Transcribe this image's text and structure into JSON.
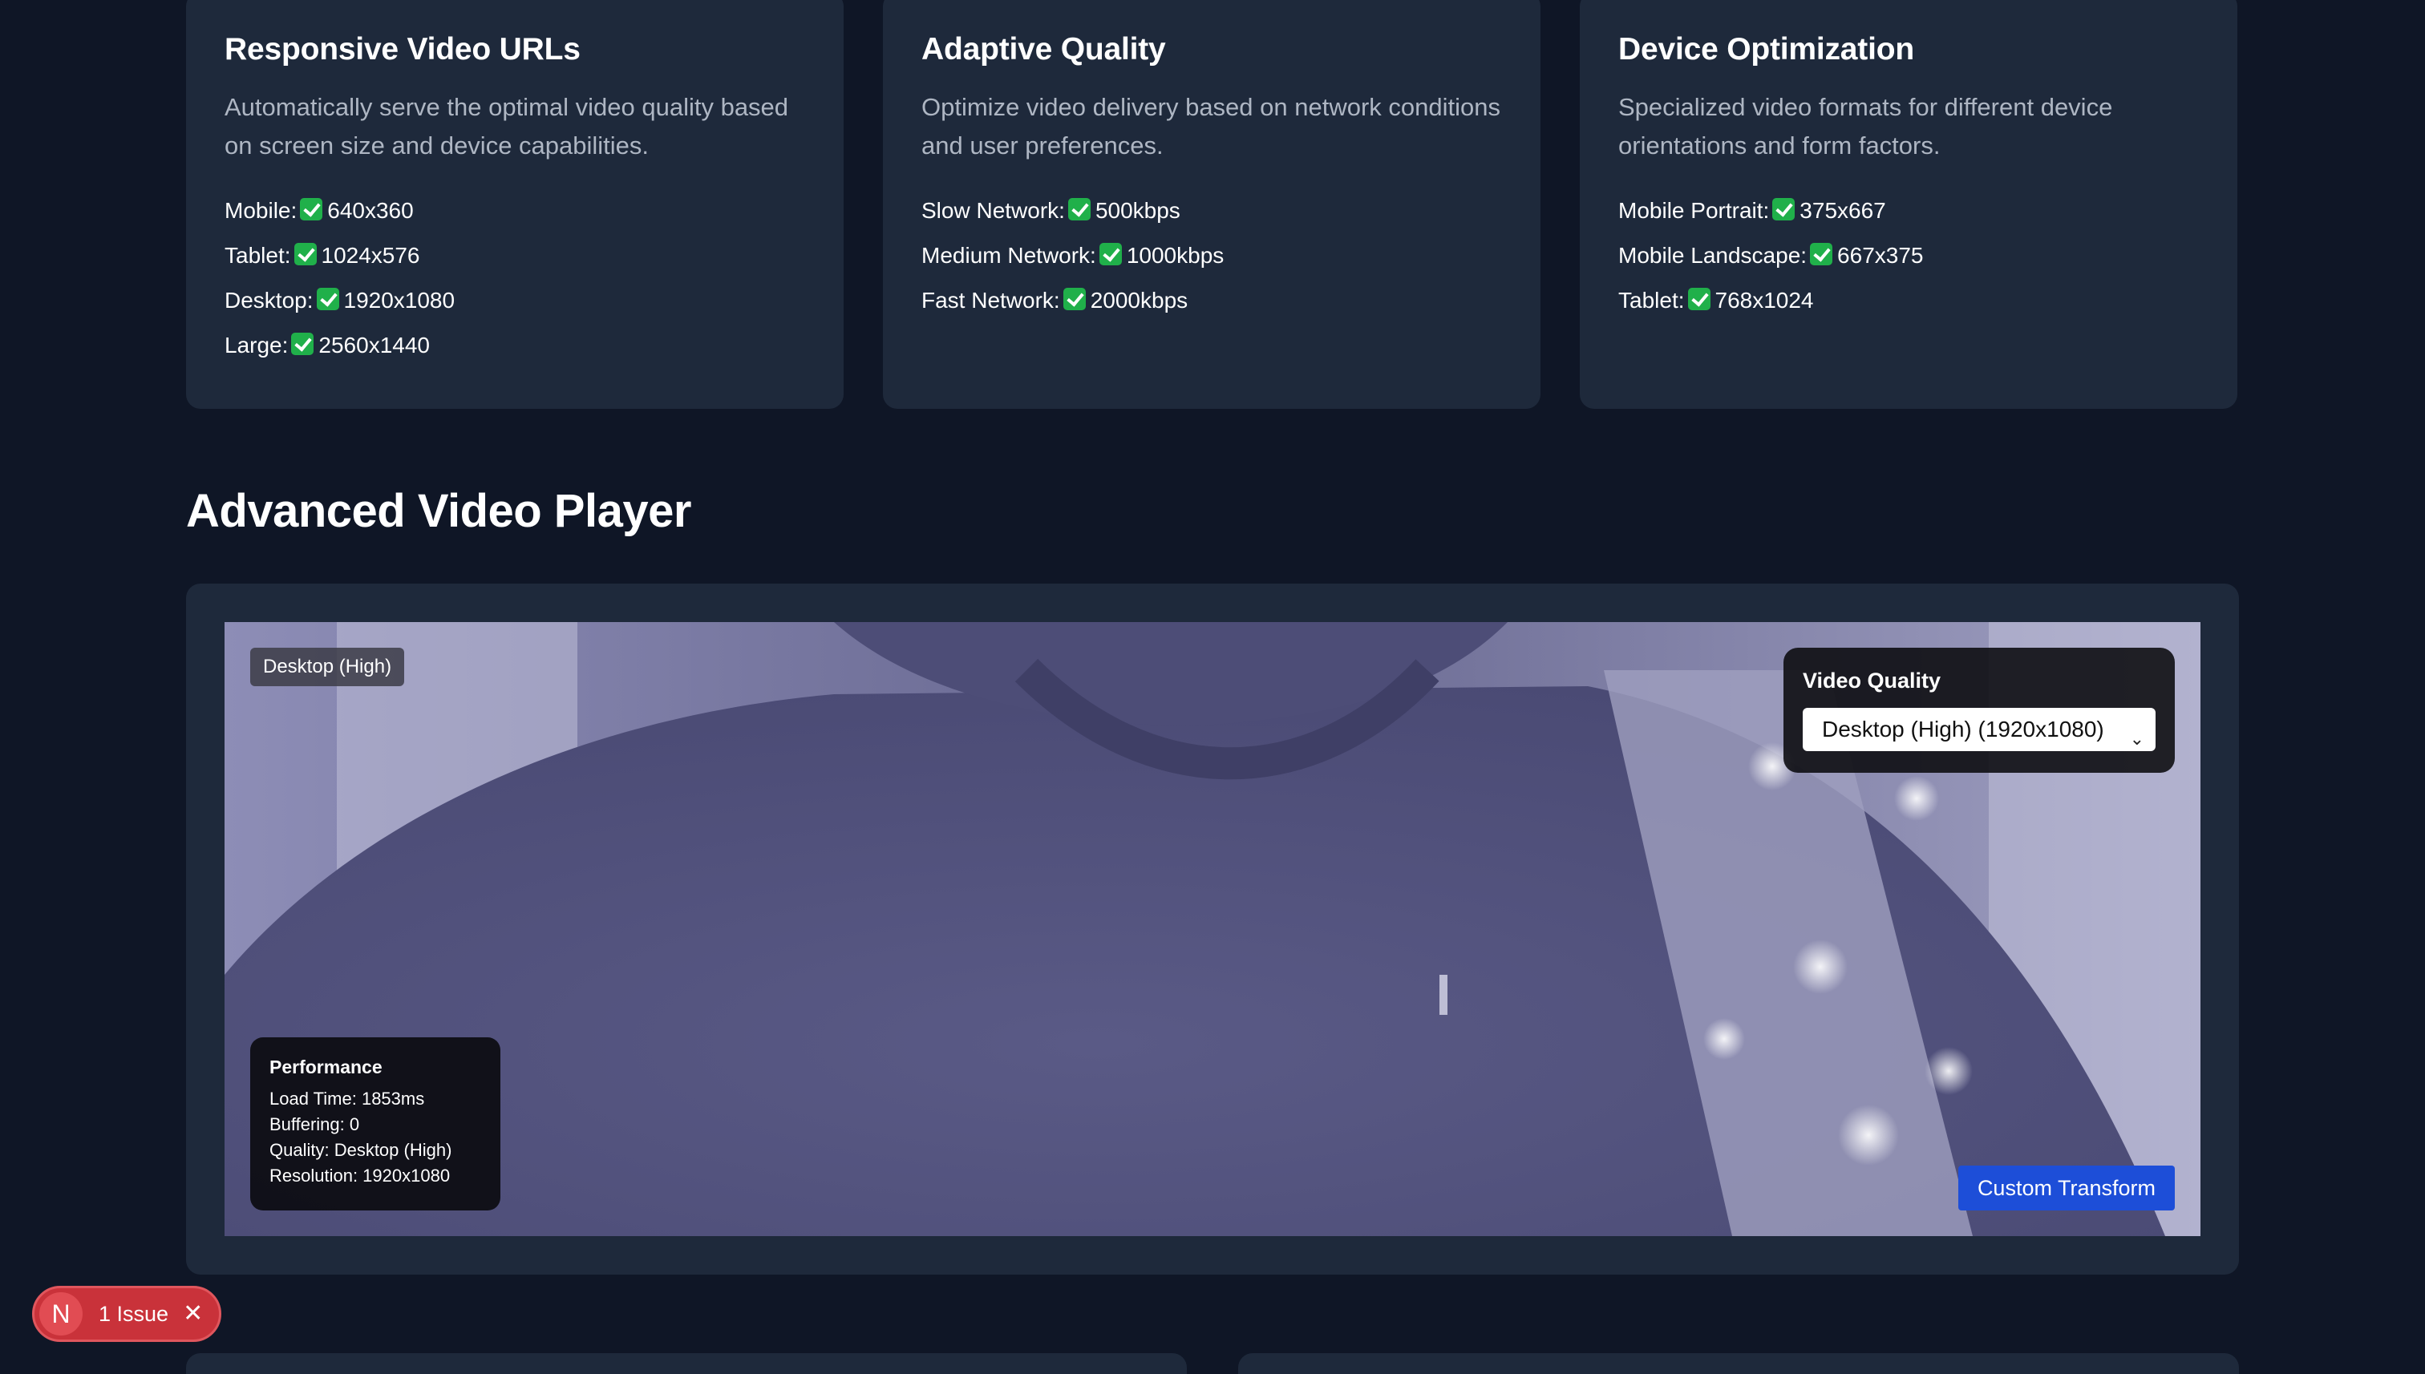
{
  "cards": [
    {
      "title": "Responsive Video URLs",
      "description": "Automatically serve the optimal video quality based on screen size and device capabilities.",
      "items": [
        {
          "label": "Mobile:",
          "value": "640x360"
        },
        {
          "label": "Tablet:",
          "value": "1024x576"
        },
        {
          "label": "Desktop:",
          "value": "1920x1080"
        },
        {
          "label": "Large:",
          "value": "2560x1440"
        }
      ]
    },
    {
      "title": "Adaptive Quality",
      "description": "Optimize video delivery based on network conditions and user preferences.",
      "items": [
        {
          "label": "Slow Network:",
          "value": "500kbps"
        },
        {
          "label": "Medium Network:",
          "value": "1000kbps"
        },
        {
          "label": "Fast Network:",
          "value": "2000kbps"
        }
      ]
    },
    {
      "title": "Device Optimization",
      "description": "Specialized video formats for different device orientations and form factors.",
      "items": [
        {
          "label": "Mobile Portrait:",
          "value": "375x667"
        },
        {
          "label": "Mobile Landscape:",
          "value": "667x375"
        },
        {
          "label": "Tablet:",
          "value": "768x1024"
        }
      ]
    }
  ],
  "section_title": "Advanced Video Player",
  "player": {
    "quality_tag": "Desktop (High)",
    "quality_label": "Video Quality",
    "quality_selected": "Desktop (High) (1920x1080)",
    "performance": {
      "title": "Performance",
      "load_time": "Load Time: 1853ms",
      "buffering": "Buffering: 0",
      "quality": "Quality: Desktop (High)",
      "resolution": "Resolution: 1920x1080"
    },
    "custom_transform_label": "Custom Transform"
  },
  "issue_badge": {
    "logo": "N",
    "text": "1 Issue",
    "close_icon": "close-icon"
  },
  "colors": {
    "page_bg": "#0f1626",
    "card_bg": "#1e293b",
    "button_blue": "#1d4ed8",
    "check_green": "#20b04a",
    "issue_red": "#c9323a"
  }
}
